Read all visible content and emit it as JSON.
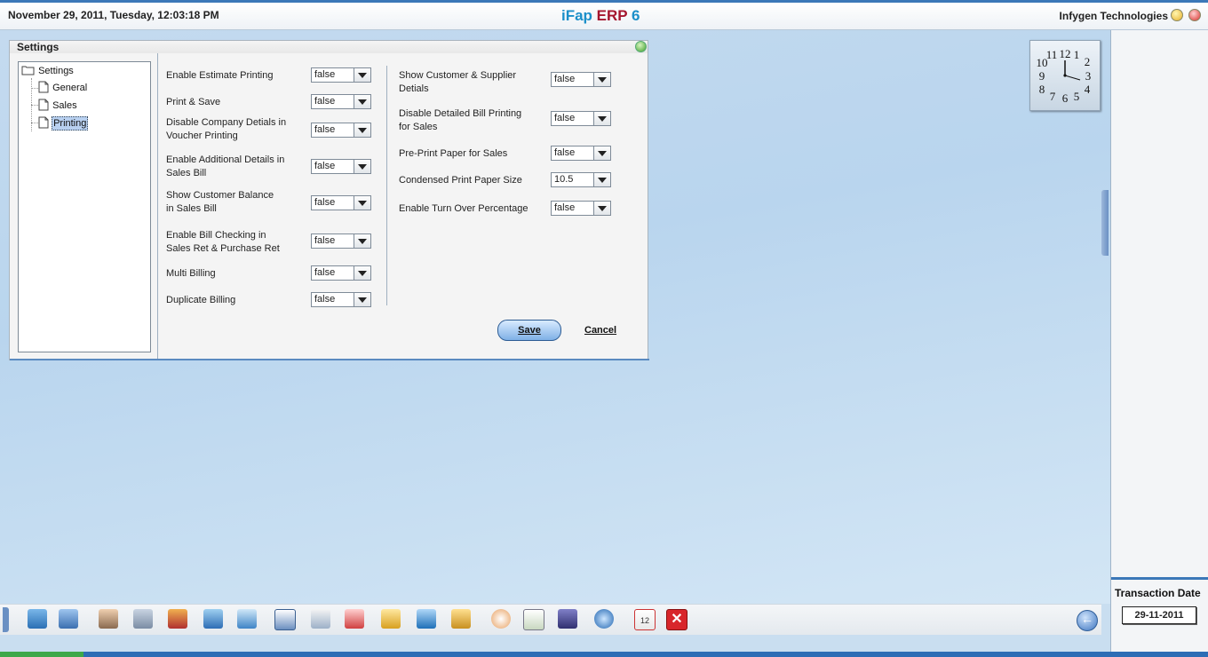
{
  "header": {
    "datetime": "November  29, 2011, Tuesday, 12:03:18 PM",
    "title_part1": "iFap ",
    "title_part2": "ERP ",
    "title_part3": "6",
    "company": "Infygen Technologies"
  },
  "dialog": {
    "title": "Settings",
    "tree": {
      "root": "Settings",
      "children": [
        "General",
        "Sales",
        "Printing"
      ],
      "selected": "Printing"
    },
    "left_options": [
      {
        "label": "Enable Estimate Printing",
        "value": "false"
      },
      {
        "label": "Print & Save",
        "value": "false"
      },
      {
        "label": "Disable Company Detials in Voucher Printing",
        "value": "false"
      },
      {
        "label": "Enable Additional Details in Sales Bill",
        "value": "false"
      },
      {
        "label": "Show Customer Balance in Sales Bill",
        "value": "false"
      },
      {
        "label": "Enable Bill Checking in Sales Ret & Purchase Ret",
        "value": "false"
      },
      {
        "label": "Multi Billing",
        "value": "false"
      },
      {
        "label": "Duplicate Billing",
        "value": "false"
      }
    ],
    "right_options": [
      {
        "label": "Show Customer & Supplier Detials",
        "value": "false"
      },
      {
        "label": "Disable Detailed Bill Printing for Sales",
        "value": "false"
      },
      {
        "label": "Pre-Print Paper for Sales",
        "value": "false"
      },
      {
        "label": "Condensed Print Paper Size",
        "value": "10.5"
      },
      {
        "label": "Enable Turn Over Percentage",
        "value": "false"
      }
    ],
    "save_label": "Save",
    "cancel_label": "Cancel"
  },
  "right_panel": {
    "transaction_label": "Transaction Date",
    "transaction_date": "29-11-2011"
  },
  "clock": {
    "numbers": [
      "12",
      "1",
      "2",
      "3",
      "4",
      "5",
      "6",
      "7",
      "8",
      "9",
      "10",
      "11"
    ],
    "time": "12:03"
  },
  "taskbar": {
    "icons": [
      "inventory-icon",
      "user-icon",
      "employee-icon",
      "network-icon",
      "books-icon",
      "cart-icon",
      "refresh-icon",
      "window-icon",
      "report-icon",
      "chart-icon",
      "tree-icon",
      "shapes-icon",
      "package-icon",
      "target-icon",
      "calculator-icon",
      "save-disk-icon",
      "gear-icon",
      "calendar-icon",
      "close-icon"
    ],
    "calendar_day": "12",
    "close_glyph": "✕"
  }
}
